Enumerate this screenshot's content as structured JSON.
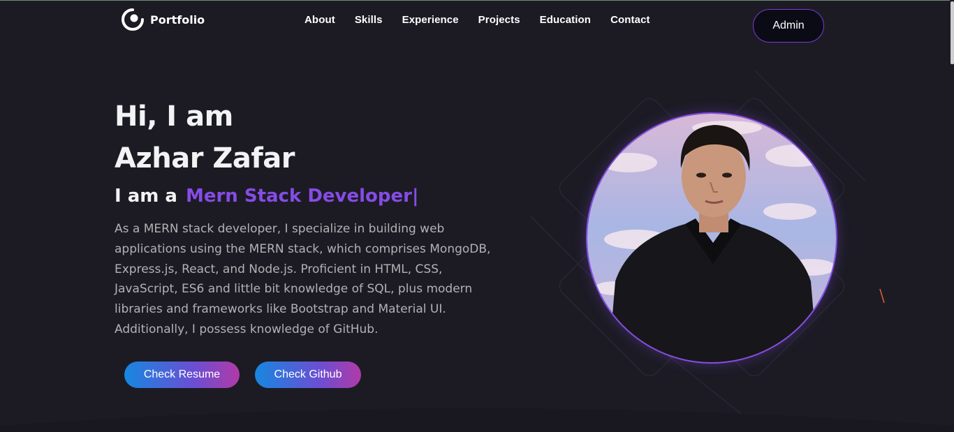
{
  "brand": {
    "name": "Portfolio",
    "icon": "portfolio-logo-icon"
  },
  "nav": {
    "items": [
      "About",
      "Skills",
      "Experience",
      "Projects",
      "Education",
      "Contact"
    ],
    "admin_label": "Admin"
  },
  "hero": {
    "greeting": "Hi, I am",
    "name": "Azhar Zafar",
    "role_prefix": "I am a",
    "role_value": "Mern Stack Developer",
    "cursor": "|",
    "description": "As a MERN stack developer, I specialize in building web applications using the MERN stack, which comprises MongoDB, Express.js, React, and Node.js. Proficient in HTML, CSS, JavaScript, ES6 and little bit knowledge of SQL, plus modern libraries and frameworks like Bootstrap and Material UI. Additionally, I possess knowledge of GitHub.",
    "buttons": {
      "resume": "Check Resume",
      "github": "Check Github"
    }
  },
  "colors": {
    "background": "#1c1b24",
    "accent": "#854ce6",
    "text_primary": "#f2f3f4",
    "text_secondary": "#b1b2b3",
    "button_gradient_start": "#1787e0",
    "button_gradient_end": "#b03aa8"
  }
}
